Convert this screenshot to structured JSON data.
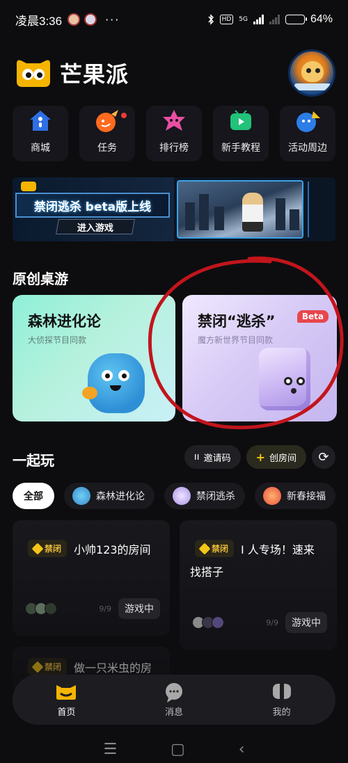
{
  "status_bar": {
    "time": "凌晨3:36",
    "dots": "···",
    "hd": "HD",
    "network": "5G",
    "battery": "64%",
    "battery_level": 0.64
  },
  "header": {
    "app_name": "芒果派",
    "brand_color": "#f5b400"
  },
  "quick_nav": [
    {
      "label": "商城",
      "icon": "shop-icon"
    },
    {
      "label": "任务",
      "icon": "task-icon"
    },
    {
      "label": "排行榜",
      "icon": "leaderboard-icon"
    },
    {
      "label": "新手教程",
      "icon": "tutorial-icon"
    },
    {
      "label": "活动周边",
      "icon": "events-icon"
    }
  ],
  "banner": {
    "title": "禁闭逃杀 beta版上线",
    "button": "进入游戏"
  },
  "original_games": {
    "title": "原创桌游",
    "cards": [
      {
        "title": "森林进化论",
        "subtitle": "大侦探节目同款"
      },
      {
        "title": "禁闭“逃杀”",
        "subtitle": "魔方新世界节目同款",
        "badge": "Beta"
      }
    ]
  },
  "play_together": {
    "title": "一起玩",
    "invite_code": "邀请码",
    "create_room": "创房间",
    "filters": [
      "全部",
      "森林进化论",
      "禁闭逃杀",
      "新春接福"
    ]
  },
  "rooms": [
    {
      "tag": "禁闭",
      "name": "小帅123的房间",
      "count": "9/9",
      "state": "游戏中"
    },
    {
      "tag": "禁闭",
      "name": "I 人专场！速来",
      "name_line2": "找搭子",
      "count": "9/9",
      "state": "游戏中"
    },
    {
      "tag": "禁闭",
      "name": "做一只米虫的房"
    }
  ],
  "tab_bar": [
    {
      "label": "首页",
      "active": true
    },
    {
      "label": "消息",
      "active": false
    },
    {
      "label": "我的",
      "active": false
    }
  ],
  "system_nav": {
    "menu": "☰",
    "home": "▢",
    "back": "‹"
  }
}
